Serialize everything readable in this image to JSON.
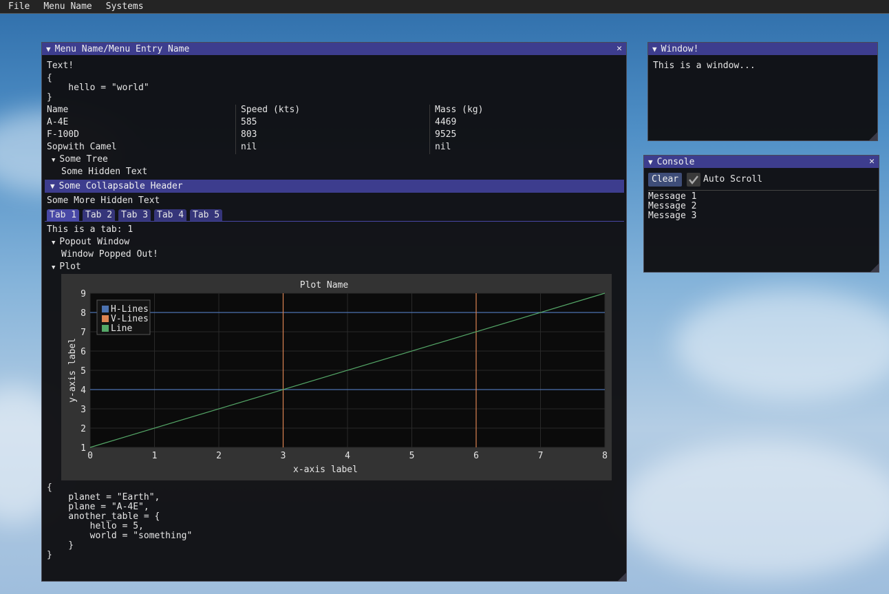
{
  "menubar": {
    "items": [
      "File",
      "Menu Name",
      "Systems"
    ]
  },
  "main_window": {
    "title": "Menu Name/Menu Entry Name",
    "text": "Text!",
    "json_small": [
      "{",
      "    hello = \"world\"",
      "}"
    ],
    "table": {
      "headers": [
        "Name",
        "Speed (kts)",
        "Mass (kg)"
      ],
      "rows": [
        [
          "A-4E",
          "585",
          "4469"
        ],
        [
          "F-100D",
          "803",
          "9525"
        ],
        [
          "Sopwith Camel",
          "nil",
          "nil"
        ]
      ]
    },
    "tree": {
      "label": "Some Tree",
      "content": "Some Hidden Text"
    },
    "collapsable_header": {
      "label": "Some Collapsable Header",
      "content": "Some More Hidden Text"
    },
    "tabs": [
      "Tab 1",
      "Tab 2",
      "Tab 3",
      "Tab 4",
      "Tab 5"
    ],
    "tab_content": "This is a tab: 1",
    "popout": {
      "label": "Popout Window",
      "content": "Window Popped Out!"
    },
    "plot_node": {
      "label": "Plot"
    },
    "json_large": [
      "{",
      "    planet = \"Earth\",",
      "    plane = \"A-4E\",",
      "    another_table = {",
      "        hello = 5,",
      "        world = \"something\"",
      "    }",
      "}"
    ]
  },
  "small_window": {
    "title": "Window!",
    "text": "This is a window..."
  },
  "console": {
    "title": "Console",
    "clear_label": "Clear",
    "auto_scroll_label": "Auto Scroll",
    "auto_scroll_checked": true,
    "messages": [
      "Message 1",
      "Message 2",
      "Message 3"
    ]
  },
  "icons": {
    "collapse": "triangle-down-icon",
    "close": "close-icon",
    "check": "checkmark-icon"
  },
  "colors": {
    "title_bar": "#3d3d8e",
    "hline": "#4c72b0",
    "vline": "#dd8452",
    "line": "#55a868"
  },
  "chart_data": {
    "type": "line",
    "title": "Plot Name",
    "xlabel": "x-axis label",
    "ylabel": "y-axis label",
    "xlim": [
      0,
      8
    ],
    "ylim": [
      1,
      9
    ],
    "xticks": [
      0,
      1,
      2,
      3,
      4,
      5,
      6,
      7,
      8
    ],
    "yticks": [
      1,
      2,
      3,
      4,
      5,
      6,
      7,
      8,
      9
    ],
    "grid": true,
    "legend_placement": "top-left",
    "series": [
      {
        "name": "H-Lines",
        "kind": "hlines",
        "values": [
          4,
          8
        ],
        "color": "#4c72b0"
      },
      {
        "name": "V-Lines",
        "kind": "vlines",
        "values": [
          3,
          6
        ],
        "color": "#dd8452"
      },
      {
        "name": "Line",
        "kind": "line",
        "x": [
          0,
          8
        ],
        "y": [
          1,
          9
        ],
        "color": "#55a868"
      }
    ]
  }
}
